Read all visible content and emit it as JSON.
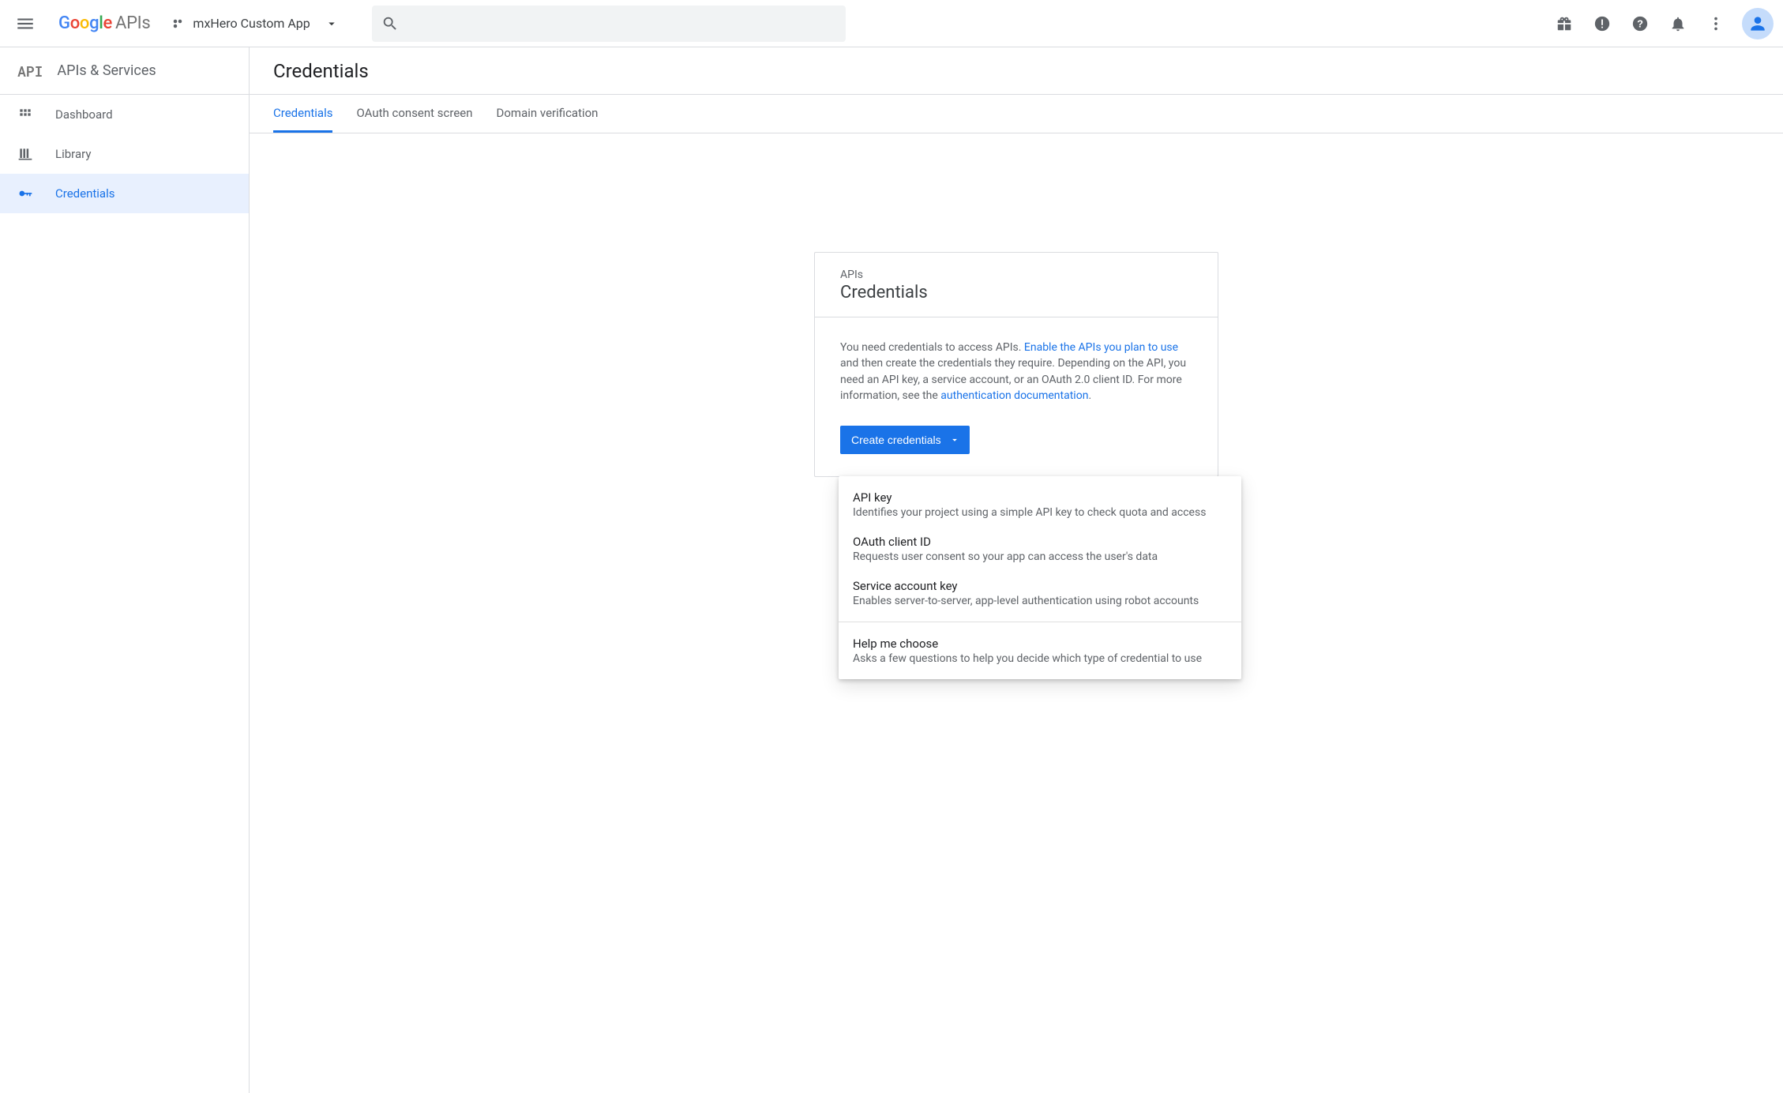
{
  "header": {
    "project_name": "mxHero Custom App",
    "search_placeholder": ""
  },
  "sidebar": {
    "title": "APIs & Services",
    "items": [
      {
        "label": "Dashboard",
        "icon": "dashboard",
        "active": false
      },
      {
        "label": "Library",
        "icon": "library",
        "active": false
      },
      {
        "label": "Credentials",
        "icon": "key",
        "active": true
      }
    ]
  },
  "main": {
    "page_title": "Credentials",
    "tabs": [
      {
        "label": "Credentials",
        "active": true
      },
      {
        "label": "OAuth consent screen",
        "active": false
      },
      {
        "label": "Domain verification",
        "active": false
      }
    ]
  },
  "card": {
    "supertitle": "APIs",
    "title": "Credentials",
    "desc_pre": "You need credentials to access APIs. ",
    "desc_link1": "Enable the APIs you plan to use",
    "desc_mid": " and then create the credentials they require. Depending on the API, you need an API key, a service account, or an OAuth 2.0 client ID. For more information, see the ",
    "desc_link2": "authentication documentation",
    "desc_post": ".",
    "button": "Create credentials"
  },
  "menu": {
    "items": [
      {
        "title": "API key",
        "desc": "Identifies your project using a simple API key to check quota and access"
      },
      {
        "title": "OAuth client ID",
        "desc": "Requests user consent so your app can access the user's data"
      },
      {
        "title": "Service account key",
        "desc": "Enables server-to-server, app-level authentication using robot accounts"
      }
    ],
    "help": {
      "title": "Help me choose",
      "desc": "Asks a few questions to help you decide which type of credential to use"
    }
  }
}
